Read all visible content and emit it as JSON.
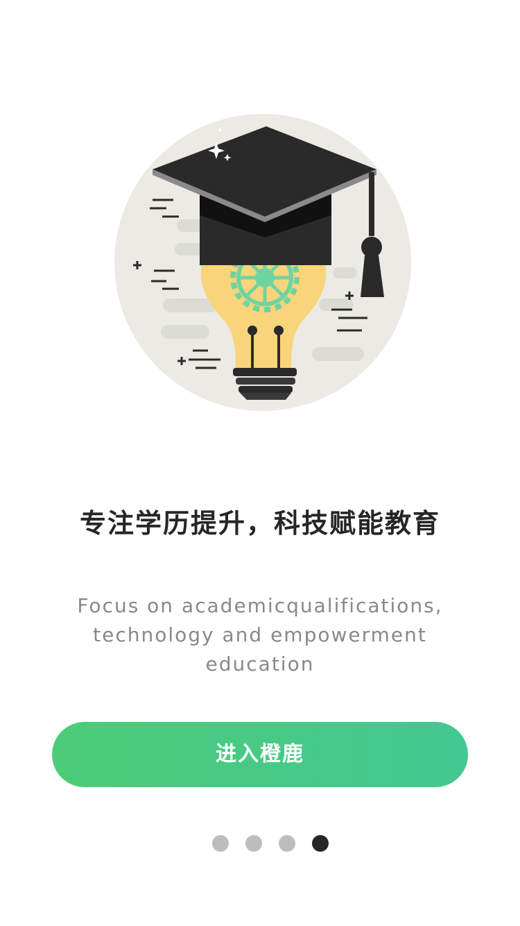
{
  "headline": "专注学历提升，科技赋能教育",
  "subtitle": {
    "line1": "Focus on academicqualifications,",
    "line2": "technology and empowerment",
    "line3": "education"
  },
  "enter_button": {
    "label": "进入橙鹿"
  },
  "pager": {
    "total": 4,
    "active_index": 3
  },
  "illustration": {
    "icon": "graduation-cap-lightbulb-illustration"
  },
  "colors": {
    "button_start": "#4ccc78",
    "button_end": "#43c892",
    "dot_active": "#262626",
    "dot_inactive": "#bdbdbd",
    "headline": "#262626",
    "subtitle": "#888888"
  }
}
